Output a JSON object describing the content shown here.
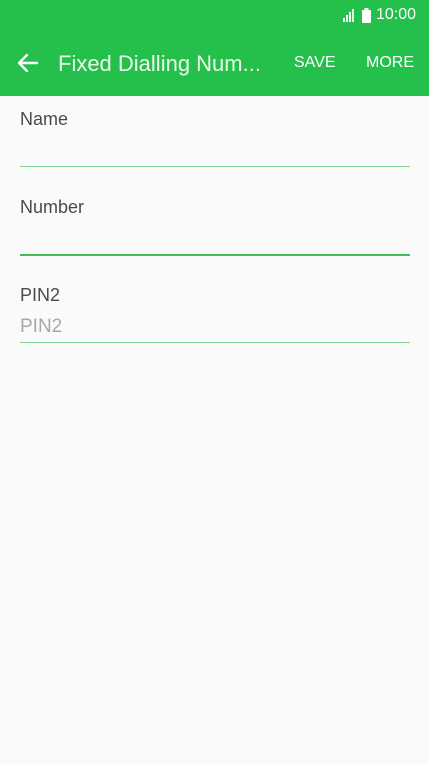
{
  "status_bar": {
    "time": "10:00",
    "signal_icon": "signal-icon",
    "battery_icon": "battery-icon"
  },
  "app_bar": {
    "back_icon": "arrow-left-icon",
    "title": "Fixed Dialling Num...",
    "save_label": "SAVE",
    "more_label": "MORE"
  },
  "form": {
    "name": {
      "label": "Name",
      "value": "",
      "placeholder": ""
    },
    "number": {
      "label": "Number",
      "value": "",
      "placeholder": ""
    },
    "pin2": {
      "label": "PIN2",
      "value": "",
      "placeholder": "PIN2"
    }
  },
  "colors": {
    "accent": "#25bf4c",
    "underline": "#7fd38f",
    "underline_active": "#3fbf5b",
    "background": "#fafafa"
  }
}
